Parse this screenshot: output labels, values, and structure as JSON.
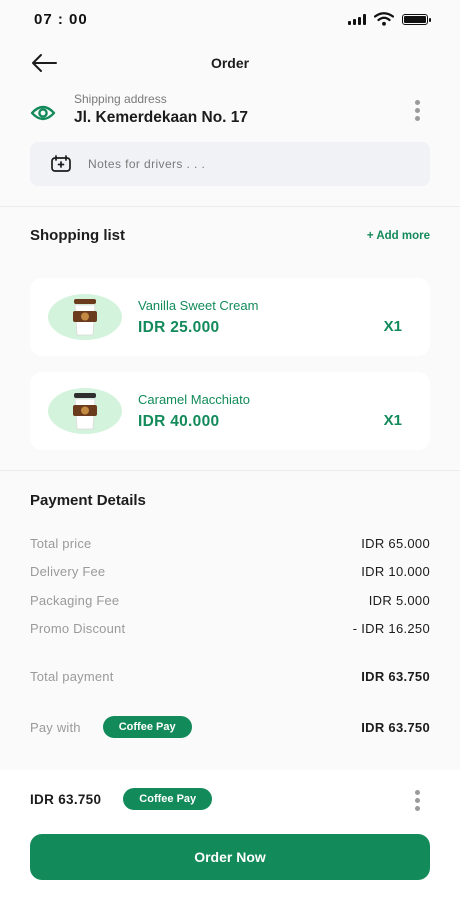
{
  "status_bar": {
    "time": "07 : 00"
  },
  "header": {
    "title": "Order"
  },
  "address": {
    "label": "Shipping address",
    "value": "Jl. Kemerdekaan No. 17"
  },
  "notes": {
    "placeholder": "Notes for drivers . . ."
  },
  "shopping_list": {
    "title": "Shopping list",
    "add_more": "+ Add more",
    "items": [
      {
        "name": "Vanilla Sweet Cream",
        "price": "IDR 25.000",
        "qty": "X1",
        "cup_color": "#6b3b1d"
      },
      {
        "name": "Caramel Macchiato",
        "price": "IDR 40.000",
        "qty": "X1",
        "cup_color": "#2f2f2f"
      }
    ]
  },
  "payment_details": {
    "title": "Payment Details",
    "rows": [
      {
        "label": "Total price",
        "value": "IDR 65.000"
      },
      {
        "label": "Delivery Fee",
        "value": "IDR 10.000"
      },
      {
        "label": "Packaging Fee",
        "value": "IDR 5.000"
      },
      {
        "label": "Promo Discount",
        "value": "- IDR 16.250"
      }
    ],
    "total_label": "Total payment",
    "total_value": "IDR 63.750",
    "pay_with_label": "Pay with",
    "pay_with_method": "Coffee Pay",
    "pay_with_value": "IDR 63.750"
  },
  "bottom": {
    "amount": "IDR 63.750",
    "method": "Coffee Pay",
    "order_button": "Order Now"
  },
  "colors": {
    "accent": "#138a5a",
    "light_accent": "#d3f3dc",
    "background": "#fafafa"
  }
}
